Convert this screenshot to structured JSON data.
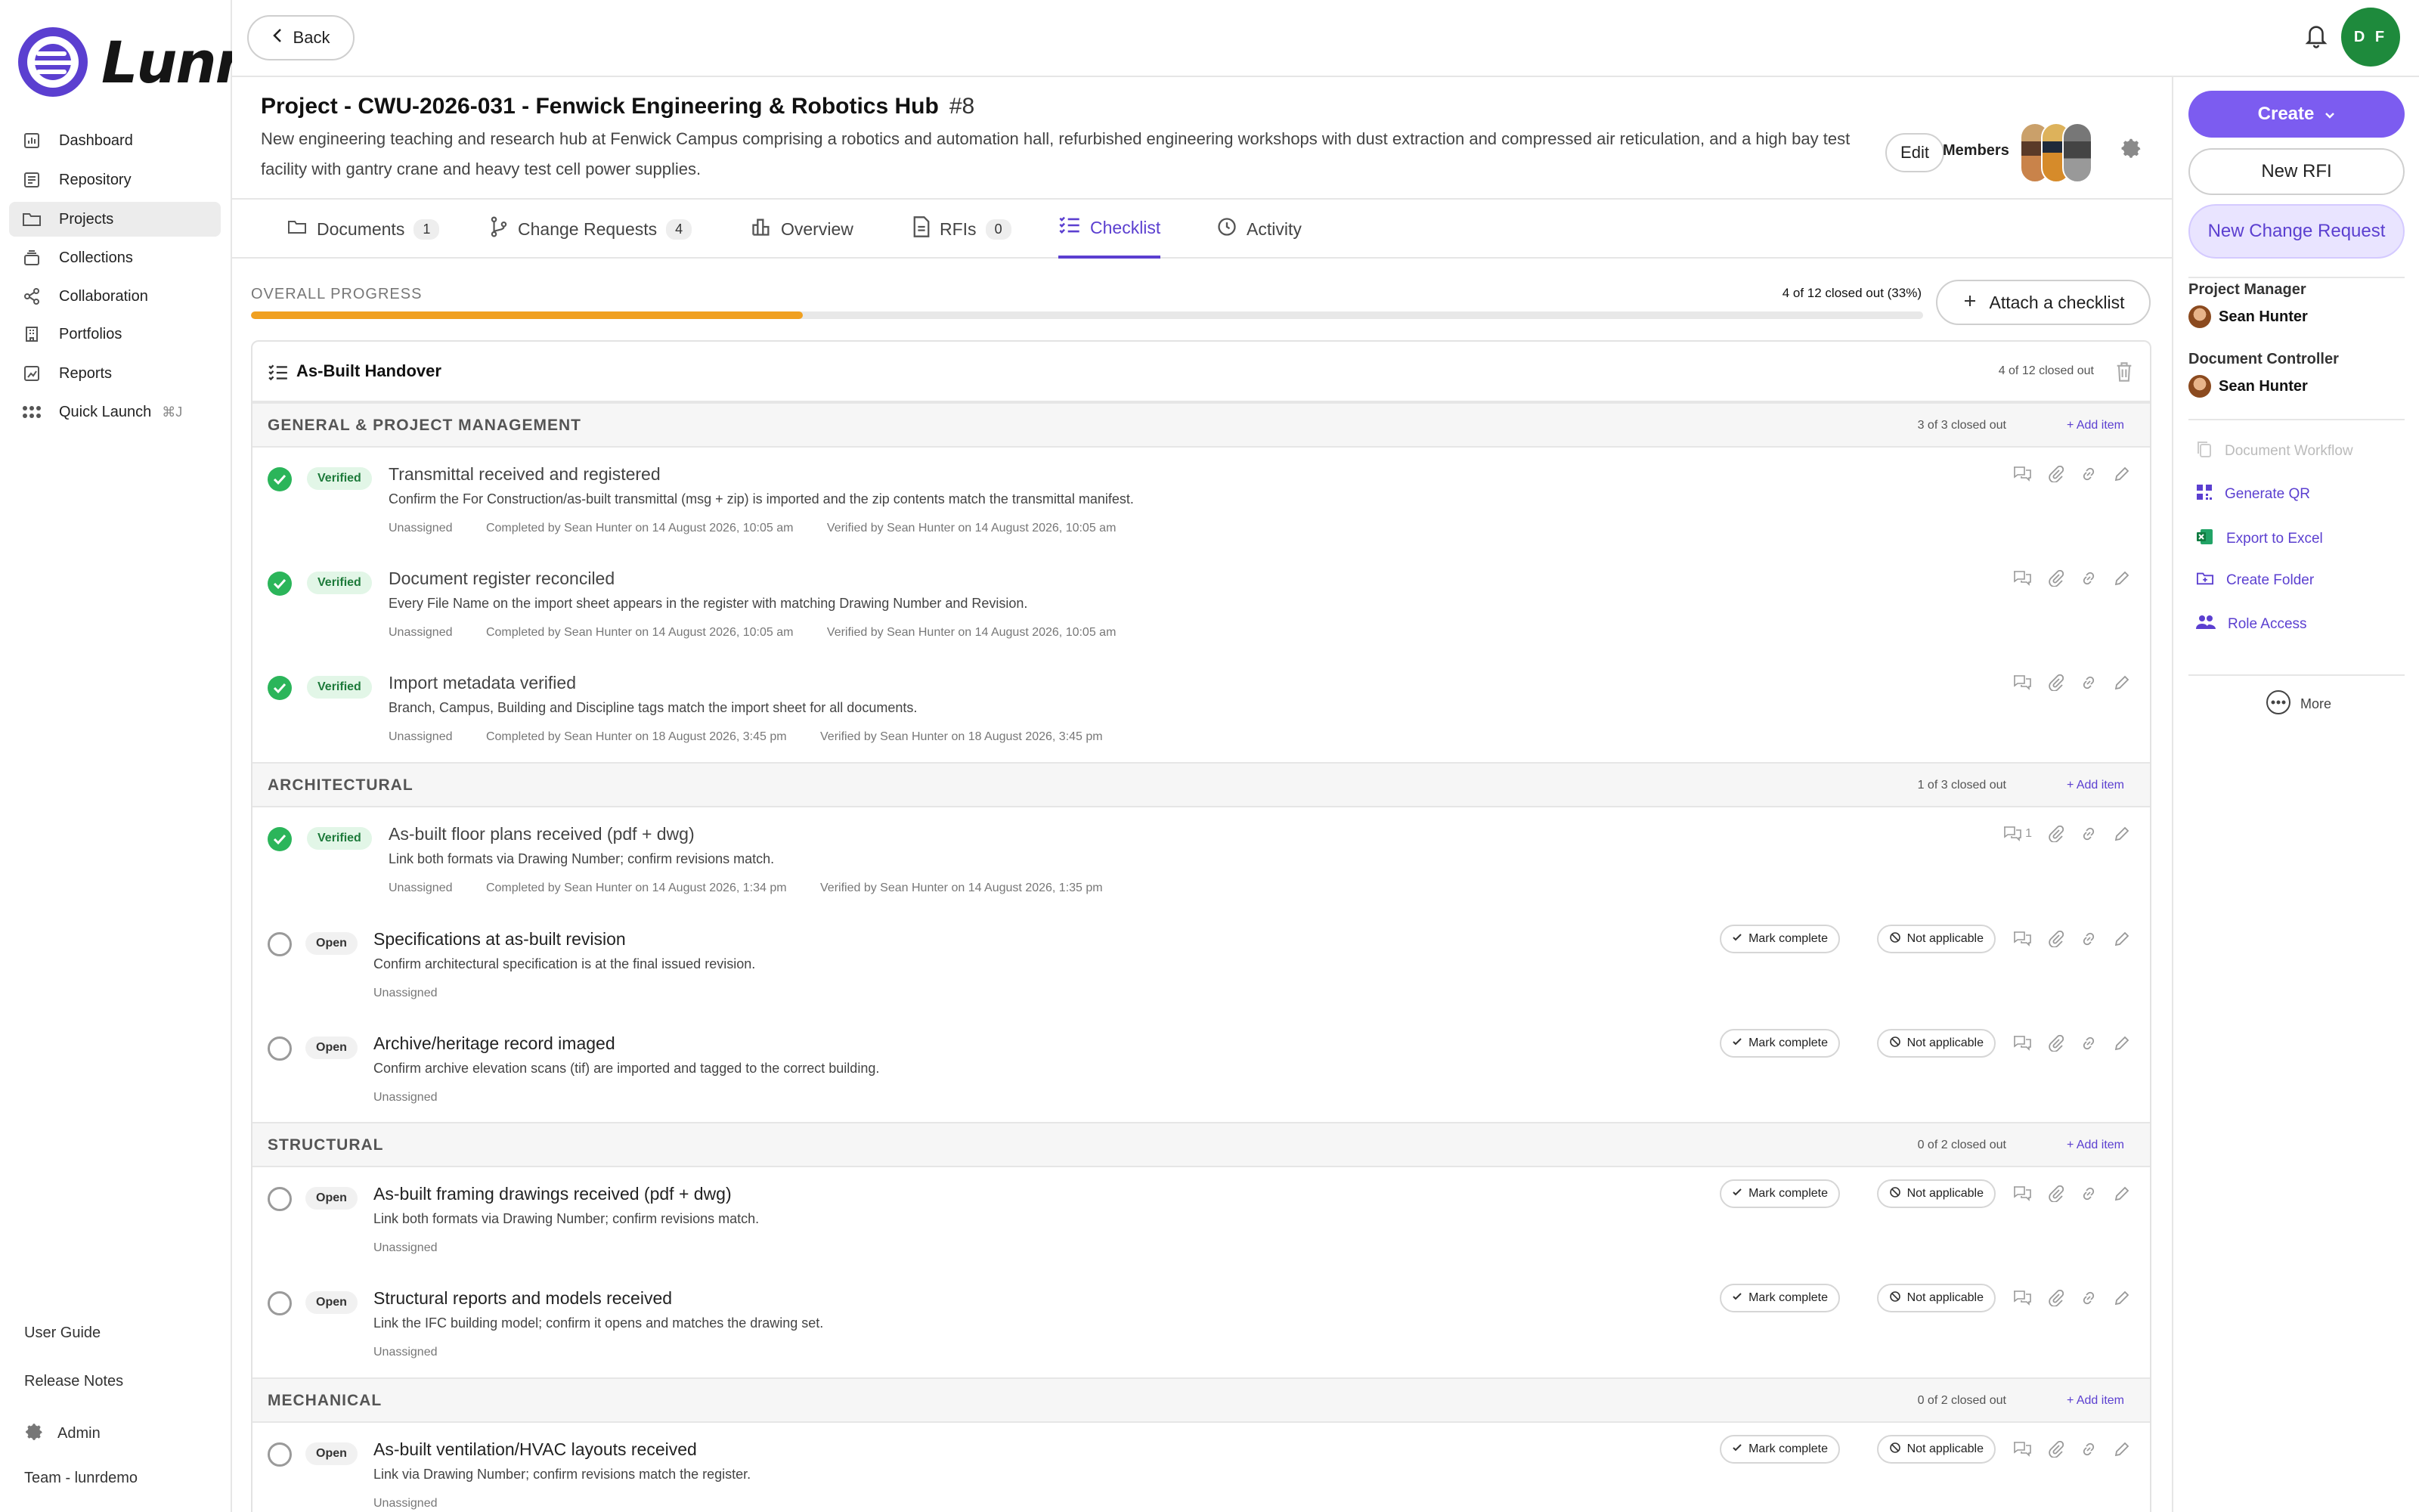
{
  "app": {
    "name": "Lunr"
  },
  "sidebar": {
    "items": [
      {
        "label": "Dashboard",
        "icon": "chart-icon"
      },
      {
        "label": "Repository",
        "icon": "archive-icon"
      },
      {
        "label": "Projects",
        "icon": "folder-icon",
        "active": true
      },
      {
        "label": "Collections",
        "icon": "collection-icon"
      },
      {
        "label": "Collaboration",
        "icon": "share-icon"
      },
      {
        "label": "Portfolios",
        "icon": "building-icon"
      },
      {
        "label": "Reports",
        "icon": "report-icon"
      },
      {
        "label": "Quick Launch",
        "icon": "grid-icon",
        "shortcut": "⌘J"
      }
    ],
    "footer": {
      "user_guide": "User Guide",
      "release_notes": "Release Notes",
      "admin": "Admin",
      "team": "Team - lunrdemo"
    }
  },
  "topbar": {
    "back_label": "Back",
    "user_initials": "D F"
  },
  "project": {
    "title": "Project - CWU-2026-031 - Fenwick Engineering & Robotics Hub",
    "number": "#8",
    "description": "New engineering teaching and research hub at Fenwick Campus comprising a robotics and automation hall, refurbished engineering workshops with dust extraction and compressed air reticulation, and a high bay test facility with gantry crane and heavy test cell power supplies.",
    "edit_label": "Edit",
    "members_label": "Members"
  },
  "tabs": [
    {
      "label": "Documents",
      "count": "1"
    },
    {
      "label": "Change Requests",
      "count": "4"
    },
    {
      "label": "Overview",
      "count": null
    },
    {
      "label": "RFIs",
      "count": "0"
    },
    {
      "label": "Checklist",
      "count": null,
      "active": true
    },
    {
      "label": "Activity",
      "count": null
    }
  ],
  "progress": {
    "label": "OVERALL PROGRESS",
    "summary": "4 of 12 closed out (33%)",
    "fraction": 0.33,
    "attach_label": "Attach a checklist"
  },
  "checklist": {
    "title": "As-Built Handover",
    "count": "4 of 12 closed out",
    "labels": {
      "add_item": "Add item",
      "mark_complete": "Mark complete",
      "not_applicable": "Not applicable",
      "verified": "Verified",
      "open": "Open"
    },
    "sections": [
      {
        "title": "GENERAL & PROJECT MANAGEMENT",
        "count": "3 of 3 closed out"
      },
      {
        "title": "ARCHITECTURAL",
        "count": "1 of 3 closed out"
      },
      {
        "title": "STRUCTURAL",
        "count": "0 of 2 closed out"
      },
      {
        "title": "MECHANICAL",
        "count": "0 of 2 closed out"
      }
    ],
    "items": [
      {
        "status": "Verified",
        "title": "Transmittal received and registered",
        "desc": "Confirm the For Construction/as-built transmittal (msg + zip) is imported and the zip contents match the transmittal manifest.",
        "assignee": "Unassigned",
        "completed": "Completed by Sean Hunter on 14 August 2026, 10:05 am",
        "verified": "Verified by Sean Hunter on 14 August 2026, 10:05 am",
        "comments": ""
      },
      {
        "status": "Verified",
        "title": "Document register reconciled",
        "desc": "Every File Name on the import sheet appears in the register with matching Drawing Number and Revision.",
        "assignee": "Unassigned",
        "completed": "Completed by Sean Hunter on 14 August 2026, 10:05 am",
        "verified": "Verified by Sean Hunter on 14 August 2026, 10:05 am",
        "comments": ""
      },
      {
        "status": "Verified",
        "title": "Import metadata verified",
        "desc": "Branch, Campus, Building and Discipline tags match the import sheet for all documents.",
        "assignee": "Unassigned",
        "completed": "Completed by Sean Hunter on 18 August 2026, 3:45 pm",
        "verified": "Verified by Sean Hunter on 18 August 2026, 3:45 pm",
        "comments": ""
      },
      {
        "status": "Verified",
        "title": "As-built floor plans received (pdf + dwg)",
        "desc": "Link both formats via Drawing Number; confirm revisions match.",
        "assignee": "Unassigned",
        "completed": "Completed by Sean Hunter on 14 August 2026, 1:34 pm",
        "verified": "Verified by Sean Hunter on 14 August 2026, 1:35 pm",
        "comments": "1"
      },
      {
        "status": "Open",
        "title": "Specifications at as-built revision",
        "desc": "Confirm architectural specification is at the final issued revision.",
        "assignee": "Unassigned"
      },
      {
        "status": "Open",
        "title": "Archive/heritage record imaged",
        "desc": "Confirm archive elevation scans (tif) are imported and tagged to the correct building.",
        "assignee": "Unassigned"
      },
      {
        "status": "Open",
        "title": "As-built framing drawings received (pdf + dwg)",
        "desc": "Link both formats via Drawing Number; confirm revisions match.",
        "assignee": "Unassigned"
      },
      {
        "status": "Open",
        "title": "Structural reports and models received",
        "desc": "Link the IFC building model; confirm it opens and matches the drawing set.",
        "assignee": "Unassigned"
      },
      {
        "status": "Open",
        "title": "As-built ventilation/HVAC layouts received",
        "desc": "Link via Drawing Number; confirm revisions match the register.",
        "assignee": "Unassigned"
      }
    ]
  },
  "right_panel": {
    "create_label": "Create",
    "new_rfi_label": "New RFI",
    "new_cr_label": "New Change Request",
    "project_manager_label": "Project Manager",
    "project_manager": "Sean Hunter",
    "document_controller_label": "Document Controller",
    "document_controller": "Sean Hunter",
    "actions": [
      {
        "label": "Document Workflow",
        "icon": "copy-icon",
        "disabled": true
      },
      {
        "label": "Generate QR",
        "icon": "qr-icon"
      },
      {
        "label": "Export to Excel",
        "icon": "excel-icon"
      },
      {
        "label": "Create Folder",
        "icon": "folder-plus-icon"
      },
      {
        "label": "Role Access",
        "icon": "users-icon"
      }
    ],
    "more_label": "More"
  },
  "colors": {
    "accent": "#5b3fd0",
    "progress": "#f0a020",
    "verified": "#2bb55a",
    "avatar": "#1e8a3c"
  }
}
